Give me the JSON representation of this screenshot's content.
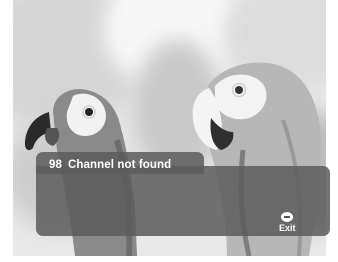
{
  "notification": {
    "channel_number": "98",
    "message": "Channel not found"
  },
  "actions": {
    "exit_label": "Exit",
    "exit_icon": "exit-button-icon"
  }
}
